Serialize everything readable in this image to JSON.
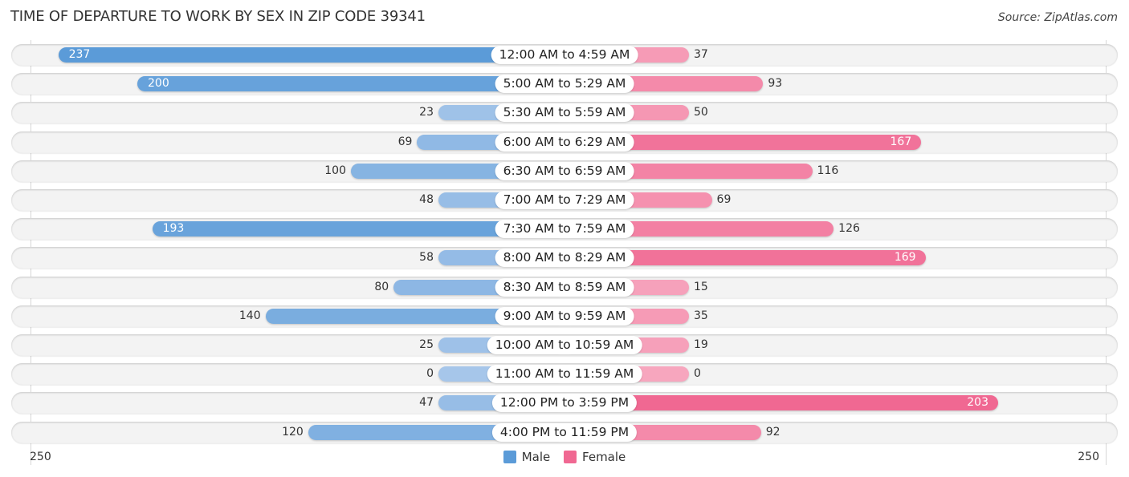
{
  "title": "TIME OF DEPARTURE TO WORK BY SEX IN ZIP CODE 39341",
  "source": "Source: ZipAtlas.com",
  "colors": {
    "male_strong": "#5b9bd8",
    "male_light": "#a6c6ea",
    "female_strong": "#f06892",
    "female_light": "#f7a6be"
  },
  "chart_data": {
    "type": "bar",
    "orientation": "horizontal-diverging",
    "title": "TIME OF DEPARTURE TO WORK BY SEX IN ZIP CODE 39341",
    "categories": [
      "12:00 AM to 4:59 AM",
      "5:00 AM to 5:29 AM",
      "5:30 AM to 5:59 AM",
      "6:00 AM to 6:29 AM",
      "6:30 AM to 6:59 AM",
      "7:00 AM to 7:29 AM",
      "7:30 AM to 7:59 AM",
      "8:00 AM to 8:29 AM",
      "8:30 AM to 8:59 AM",
      "9:00 AM to 9:59 AM",
      "10:00 AM to 10:59 AM",
      "11:00 AM to 11:59 AM",
      "12:00 PM to 3:59 PM",
      "4:00 PM to 11:59 PM"
    ],
    "series": [
      {
        "name": "Male",
        "values": [
          237,
          200,
          23,
          69,
          100,
          48,
          193,
          58,
          80,
          140,
          25,
          0,
          47,
          120
        ]
      },
      {
        "name": "Female",
        "values": [
          37,
          93,
          50,
          167,
          116,
          69,
          126,
          169,
          15,
          35,
          19,
          0,
          203,
          92
        ]
      }
    ],
    "xlim": [
      -250,
      250
    ],
    "tick_labels": {
      "left": "250",
      "right": "250"
    },
    "legend": {
      "position": "bottom-center",
      "entries": [
        "Male",
        "Female"
      ]
    },
    "grid": false
  }
}
